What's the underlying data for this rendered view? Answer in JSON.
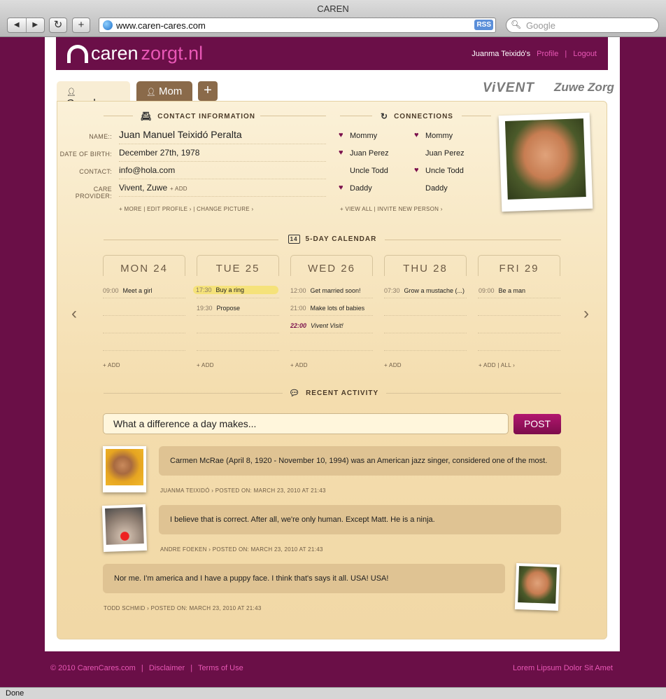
{
  "browser": {
    "title": "CAREN",
    "back": "◀",
    "forward": "▶",
    "reload": "↻",
    "new_tab": "+",
    "url": "www.caren-cares.com",
    "rss": "RSS",
    "search_placeholder": "Google",
    "status": "Done"
  },
  "header": {
    "logo_a": "caren",
    "logo_b": "zorgt.nl",
    "user": "Juanma Teixidó's",
    "profile": "Profile",
    "separator": "|",
    "logout": "Logout"
  },
  "tabs": [
    {
      "label": "Grandma"
    },
    {
      "label": "Mom"
    }
  ],
  "tab_add": "+",
  "partners": [
    "ViVENT",
    "Zuwe Zorg"
  ],
  "contact": {
    "title": "CONTACT INFORMATION",
    "rows": [
      {
        "label": "NAME::",
        "value": "Juan Manuel Teixidó Peralta"
      },
      {
        "label": "DATE OF BIRTH:",
        "value": "December 27th, 1978"
      },
      {
        "label": "CONTACT:",
        "value": "info@hola.com"
      },
      {
        "label": "CARE PROVIDER:",
        "value": "Vivent,  Zuwe"
      }
    ],
    "add": "+ ADD",
    "links": "+ MORE  |  EDIT PROFILE ›  |  CHANGE PICTURE ›"
  },
  "connections": {
    "title": "CONNECTIONS",
    "col1": [
      {
        "name": "Mommy",
        "heart": true
      },
      {
        "name": "Juan Perez",
        "heart": true
      },
      {
        "name": "Uncle Todd",
        "heart": false
      },
      {
        "name": "Daddy",
        "heart": true
      }
    ],
    "col2": [
      {
        "name": "Mommy",
        "heart": true
      },
      {
        "name": "Juan Perez",
        "heart": false
      },
      {
        "name": "Uncle Todd",
        "heart": true
      },
      {
        "name": "Daddy",
        "heart": false
      }
    ],
    "heart_symbol": "♥",
    "links": "+ VIEW ALL  |  INVITE NEW PERSON ›"
  },
  "calendar": {
    "title": "5-DAY CALENDAR",
    "icon_text": "14",
    "prev": "‹",
    "next": "›",
    "days": [
      {
        "label": "MON 24",
        "events": [
          {
            "time": "09:00",
            "text": "Meet a girl"
          }
        ],
        "add": "+ ADD"
      },
      {
        "label": "TUE 25",
        "events": [
          {
            "time": "17:30",
            "text": "Buy a ring"
          },
          {
            "time": "19:30",
            "text": "Propose"
          }
        ],
        "add": "+ ADD"
      },
      {
        "label": "WED 26",
        "events": [
          {
            "time": "12:00",
            "text": "Get married soon!"
          },
          {
            "time": "21:00",
            "text": "Make lots of babies"
          },
          {
            "time": "22:00",
            "text": "Vivent Visit!"
          }
        ],
        "add": "+ ADD"
      },
      {
        "label": "THU 28",
        "events": [
          {
            "time": "07:30",
            "text": "Grow a mustache (...)"
          }
        ],
        "add": "+ ADD"
      },
      {
        "label": "FRI 29",
        "events": [
          {
            "time": "09:00",
            "text": "Be a man"
          }
        ],
        "add": "+ ADD  |  ALL ›"
      }
    ]
  },
  "activity": {
    "title": "RECENT ACTIVITY",
    "input_value": "What a difference a day makes...",
    "post": "POST",
    "posts": [
      {
        "text": "Carmen McRae (April 8, 1920 - November 10, 1994) was an American jazz singer, considered one of the most.",
        "meta": "JUANMA TEIXIDÓ › POSTED ON: MARCH 23, 2010 AT 21:43"
      },
      {
        "text": "I believe that is correct. After all, we're only human. Except Matt. He is a ninja.",
        "meta": "ANDRE FOEKEN › POSTED ON: MARCH 23, 2010 AT 21:43"
      },
      {
        "text": "Nor me. I'm america and I have a puppy face. I think that's says it all. USA! USA!",
        "meta": "TODD SCHMID › POSTED ON: MARCH 23, 2010 AT 21:43"
      }
    ]
  },
  "footer": {
    "copyright": "© 2010 CarenCares.com",
    "sep": "|",
    "disclaimer": "Disclaimer",
    "terms": "Terms of Use",
    "right": "Lorem Lipsum Dolor Sit Amet"
  },
  "colors": {
    "brand": "#6b0f48",
    "accent": "#e857b5",
    "panel": "#f4ddae",
    "bubble": "#dfc393"
  }
}
